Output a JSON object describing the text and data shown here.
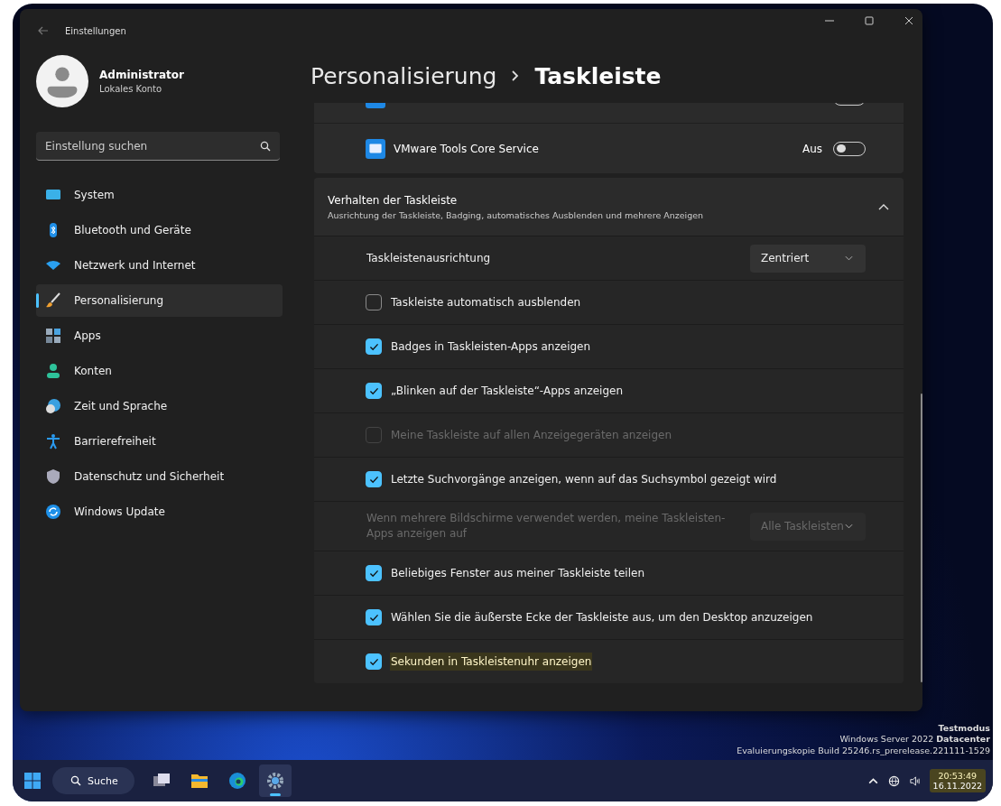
{
  "window": {
    "title": "Einstellungen"
  },
  "account": {
    "name": "Administrator",
    "type": "Lokales Konto"
  },
  "search": {
    "placeholder": "Einstellung suchen"
  },
  "nav": [
    {
      "label": "System",
      "kind": "system",
      "selected": false
    },
    {
      "label": "Bluetooth und Geräte",
      "kind": "bluetooth",
      "selected": false
    },
    {
      "label": "Netzwerk und Internet",
      "kind": "wifi",
      "selected": false
    },
    {
      "label": "Personalisierung",
      "kind": "brush",
      "selected": true
    },
    {
      "label": "Apps",
      "kind": "apps",
      "selected": false
    },
    {
      "label": "Konten",
      "kind": "person",
      "selected": false
    },
    {
      "label": "Zeit und Sprache",
      "kind": "globe",
      "selected": false
    },
    {
      "label": "Barrierefreiheit",
      "kind": "access",
      "selected": false
    },
    {
      "label": "Datenschutz und Sicherheit",
      "kind": "shield",
      "selected": false
    },
    {
      "label": "Windows Update",
      "kind": "update",
      "selected": false
    }
  ],
  "breadcrumb": [
    "Personalisierung",
    "Taskleiste"
  ],
  "app_rows": [
    {
      "on": false
    },
    {
      "label": "VMware Tools Core Service",
      "state_text": "Aus",
      "on": false
    }
  ],
  "section": {
    "title": "Verhalten der Taskleiste",
    "subtitle": "Ausrichtung der Taskleiste, Badging, automatisches Ausblenden und mehrere Anzeigen",
    "expanded": true
  },
  "settings": [
    {
      "kind": "dropdown",
      "label": "Taskleistenausrichtung",
      "value": "Zentriert",
      "disabled": false
    },
    {
      "kind": "checkbox",
      "label": "Taskleiste automatisch ausblenden",
      "checked": false,
      "disabled": false,
      "highlighted": false
    },
    {
      "kind": "checkbox",
      "label": "Badges in Taskleisten-Apps anzeigen",
      "checked": true,
      "disabled": false,
      "highlighted": false
    },
    {
      "kind": "checkbox",
      "label": "„Blinken auf der Taskleiste“-Apps anzeigen",
      "checked": true,
      "disabled": false,
      "highlighted": false
    },
    {
      "kind": "checkbox",
      "label": "Meine Taskleiste auf allen Anzeigegeräten anzeigen",
      "checked": false,
      "disabled": true,
      "highlighted": false
    },
    {
      "kind": "checkbox",
      "label": "Letzte Suchvorgänge anzeigen, wenn auf das Suchsymbol gezeigt wird",
      "checked": true,
      "disabled": false,
      "highlighted": false
    },
    {
      "kind": "dropdown",
      "label": "Wenn mehrere Bildschirme verwendet werden, meine Taskleisten-Apps anzeigen auf",
      "value": "Alle Taskleisten",
      "disabled": true
    },
    {
      "kind": "checkbox",
      "label": "Beliebiges Fenster aus meiner Taskleiste teilen",
      "checked": true,
      "disabled": false,
      "highlighted": false
    },
    {
      "kind": "checkbox",
      "label": "Wählen Sie die äußerste Ecke der Taskleiste aus, um den Desktop anzuzeigen",
      "checked": true,
      "disabled": false,
      "highlighted": false
    },
    {
      "kind": "checkbox",
      "label": "Sekunden in Taskleistenuhr anzeigen",
      "checked": true,
      "disabled": false,
      "highlighted": true
    }
  ],
  "desktop_info": [
    "Testmodus",
    "Windows Server 2022 **Datacenter**",
    "Evaluierungskopie Build 25246.rs_prerelease.221111-1529"
  ],
  "taskbar": {
    "search_label": "Suche",
    "apps": [
      {
        "kind": "taskview",
        "selected": false
      },
      {
        "kind": "explorer",
        "selected": false
      },
      {
        "kind": "edge",
        "selected": false
      },
      {
        "kind": "settings",
        "selected": true
      }
    ],
    "time": "20:53:49",
    "date": "16.11.2022",
    "clock_highlighted": true
  }
}
